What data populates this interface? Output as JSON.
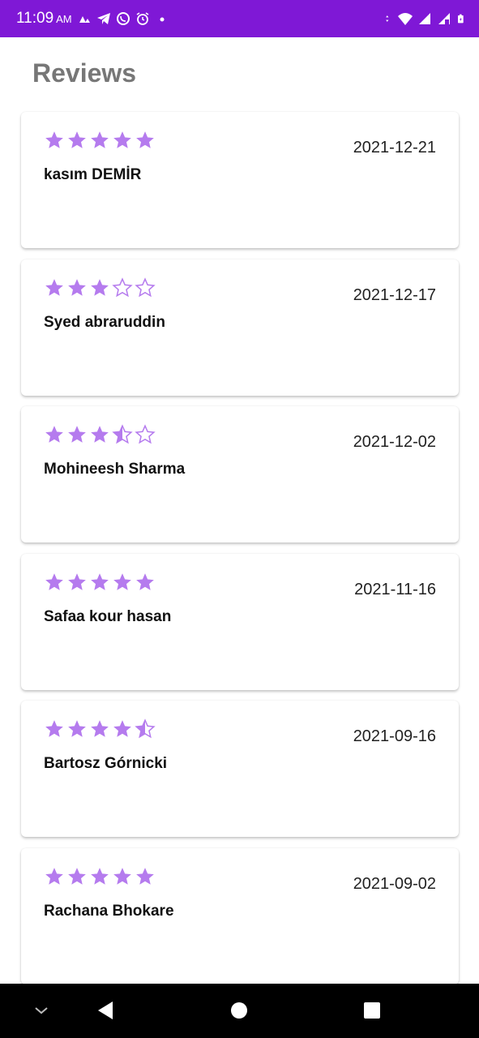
{
  "status_bar": {
    "time": "11:09",
    "ampm": "AM",
    "background": "#7f18d6"
  },
  "page": {
    "title": "Reviews"
  },
  "theme": {
    "star_color": "#b57bee"
  },
  "reviews": [
    {
      "rating": 5,
      "date": "2021-12-21",
      "name": "kasım DEMİR"
    },
    {
      "rating": 3,
      "date": "2021-12-17",
      "name": "Syed abraruddin"
    },
    {
      "rating": 3.5,
      "date": "2021-12-02",
      "name": "Mohineesh Sharma"
    },
    {
      "rating": 5,
      "date": "2021-11-16",
      "name": "Safaa kour hasan"
    },
    {
      "rating": 4.5,
      "date": "2021-09-16",
      "name": "Bartosz Górnicki"
    },
    {
      "rating": 5,
      "date": "2021-09-02",
      "name": "Rachana Bhokare"
    }
  ],
  "icons": {
    "status": [
      "strava-icon",
      "telegram-icon",
      "whatsapp-icon",
      "alarm-icon",
      "notification-dot-icon"
    ],
    "system": [
      "data-arrows-icon",
      "wifi-icon",
      "signal-icon",
      "signal-roaming-icon",
      "battery-icon"
    ],
    "nav": [
      "keyboard-hide-icon",
      "back-icon",
      "home-icon",
      "recents-icon"
    ]
  }
}
